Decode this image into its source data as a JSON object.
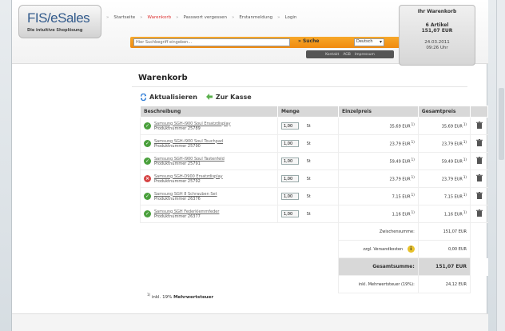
{
  "brand": {
    "title": "FIS/eSales",
    "tagline": "Die intuitive Shoplösung"
  },
  "topnav": [
    "Startseite",
    "Warenkorb",
    "Passwort vergessen",
    "Erstanmeldung",
    "Login"
  ],
  "search": {
    "placeholder": "Hier Suchbegriff eingeben...",
    "button": "Suche",
    "language": "Deutsch"
  },
  "bottomnav": [
    "Kontakt",
    "AGB",
    "Impressum"
  ],
  "cart_box": {
    "title": "Ihr Warenkorb",
    "items": "6 Artikel",
    "total": "151,07 EUR",
    "date": "24.03.2011",
    "time": "09:26 Uhr"
  },
  "page": {
    "heading": "Warenkorb",
    "refresh": "Aktualisieren",
    "checkout": "Zur Kasse"
  },
  "table": {
    "headers": [
      "Beschreibung",
      "Menge",
      "Einzelpreis",
      "Gesamtpreis"
    ],
    "rows": [
      {
        "name": "Samsung SGH-i900 Soul Ersatzdisplay",
        "nr": "Produktnummer 25789",
        "qty": "1,00",
        "unit": "St",
        "price": "35,69 EUR",
        "total": "35,69 EUR",
        "status": "ok"
      },
      {
        "name": "Samsung SGH-i900 Soul Touchpad",
        "nr": "Produktnummer 25790",
        "qty": "1,00",
        "unit": "St",
        "price": "23,79 EUR",
        "total": "23,79 EUR",
        "status": "ok"
      },
      {
        "name": "Samsung SGH-i900 Soul Tastenfeld",
        "nr": "Produktnummer 25791",
        "qty": "1,00",
        "unit": "St",
        "price": "59,49 EUR",
        "total": "59,49 EUR",
        "status": "ok"
      },
      {
        "name": "Samsung SGH-D900 Ersatzdisplay",
        "nr": "Produktnummer 25792",
        "qty": "1,00",
        "unit": "St",
        "price": "23,79 EUR",
        "total": "23,79 EUR",
        "status": "error"
      },
      {
        "name": "Samsung SGH 8 Schrauben Set",
        "nr": "Produktnummer 26376",
        "qty": "1,00",
        "unit": "St",
        "price": "7,15 EUR",
        "total": "7,15 EUR",
        "status": "ok"
      },
      {
        "name": "Samsung SGH Federklemmfeder",
        "nr": "Produktnummer 26377",
        "qty": "1,00",
        "unit": "St",
        "price": "1,16 EUR",
        "total": "1,16 EUR",
        "status": "ok"
      }
    ],
    "footnote_mark": "1)",
    "subtotal_label": "Zwischensumme:",
    "subtotal": "151,07 EUR",
    "shipping_label": "zzgl. Versandkosten",
    "shipping": "0,00 EUR",
    "grand_label": "Gesamtsumme:",
    "grand": "151,07 EUR",
    "vat_label": "inkl. Mehrwertsteuer (19%):",
    "vat": "24,12 EUR"
  },
  "footnote": {
    "mark": "1)",
    "text": "inkl. 19%",
    "bold": "Mehrwertsteuer"
  },
  "colors": {
    "accent": "#f08a10",
    "ok": "#4aa03c",
    "error": "#d64444",
    "brand": "#335b8c"
  }
}
